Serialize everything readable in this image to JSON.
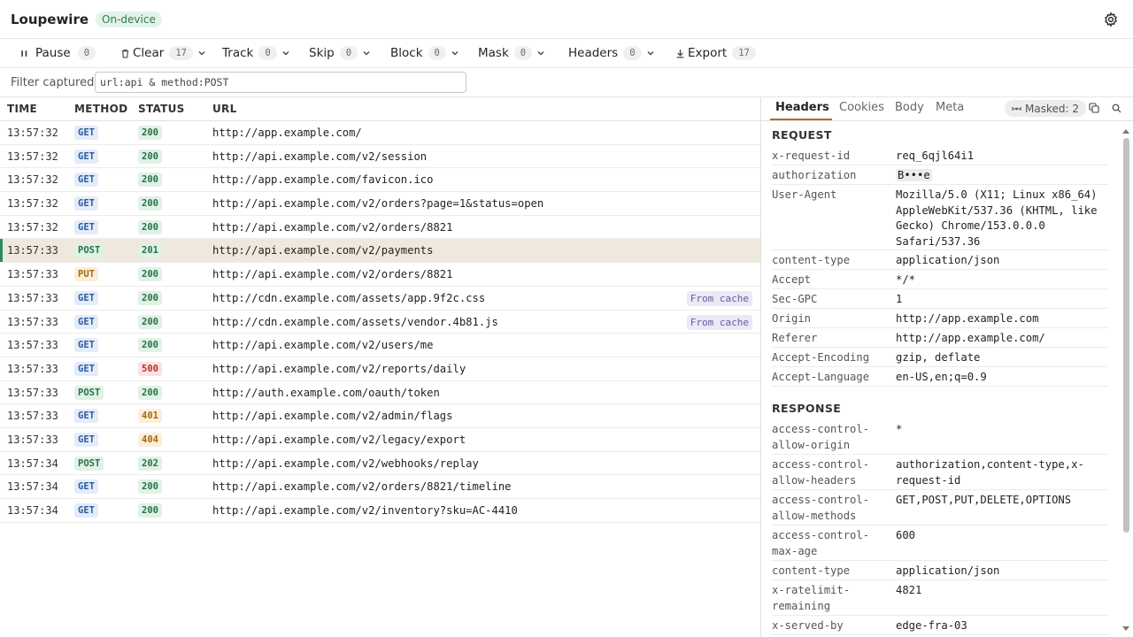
{
  "app": {
    "title": "Loupewire",
    "badge": "On-device"
  },
  "toolbar": {
    "pause": {
      "label": "Pause",
      "count": "0"
    },
    "clear": {
      "label": "Clear",
      "count": "17"
    },
    "track": {
      "label": "Track",
      "count": "0"
    },
    "skip": {
      "label": "Skip",
      "count": "0"
    },
    "block": {
      "label": "Block",
      "count": "0"
    },
    "mask": {
      "label": "Mask",
      "count": "0"
    },
    "headers": {
      "label": "Headers",
      "count": "0"
    },
    "export": {
      "label": "Export",
      "count": "17"
    }
  },
  "filter": {
    "label": "Filter captured",
    "value": "url:api & method:POST"
  },
  "table": {
    "headers": {
      "time": "TIME",
      "method": "METHOD",
      "status": "STATUS",
      "url": "URL"
    },
    "rows": [
      {
        "time": "13:57:32",
        "method": "GET",
        "status": "200",
        "url": "http://app.example.com/"
      },
      {
        "time": "13:57:32",
        "method": "GET",
        "status": "200",
        "url": "http://api.example.com/v2/session"
      },
      {
        "time": "13:57:32",
        "method": "GET",
        "status": "200",
        "url": "http://app.example.com/favicon.ico"
      },
      {
        "time": "13:57:32",
        "method": "GET",
        "status": "200",
        "url": "http://api.example.com/v2/orders?page=1&status=open"
      },
      {
        "time": "13:57:32",
        "method": "GET",
        "status": "200",
        "url": "http://api.example.com/v2/orders/8821"
      },
      {
        "time": "13:57:33",
        "method": "POST",
        "status": "201",
        "url": "http://api.example.com/v2/payments"
      },
      {
        "time": "13:57:33",
        "method": "PUT",
        "status": "200",
        "url": "http://api.example.com/v2/orders/8821"
      },
      {
        "time": "13:57:33",
        "method": "GET",
        "status": "200",
        "url": "http://cdn.example.com/assets/app.9f2c.css",
        "tag": "From cache"
      },
      {
        "time": "13:57:33",
        "method": "GET",
        "status": "200",
        "url": "http://cdn.example.com/assets/vendor.4b81.js",
        "tag": "From cache"
      },
      {
        "time": "13:57:33",
        "method": "GET",
        "status": "200",
        "url": "http://api.example.com/v2/users/me"
      },
      {
        "time": "13:57:33",
        "method": "GET",
        "status": "500",
        "url": "http://api.example.com/v2/reports/daily"
      },
      {
        "time": "13:57:33",
        "method": "POST",
        "status": "200",
        "url": "http://auth.example.com/oauth/token"
      },
      {
        "time": "13:57:33",
        "method": "GET",
        "status": "401",
        "url": "http://api.example.com/v2/admin/flags"
      },
      {
        "time": "13:57:33",
        "method": "GET",
        "status": "404",
        "url": "http://api.example.com/v2/legacy/export"
      },
      {
        "time": "13:57:34",
        "method": "POST",
        "status": "202",
        "url": "http://api.example.com/v2/webhooks/replay"
      },
      {
        "time": "13:57:34",
        "method": "GET",
        "status": "200",
        "url": "http://api.example.com/v2/orders/8821/timeline"
      },
      {
        "time": "13:57:34",
        "method": "GET",
        "status": "200",
        "url": "http://api.example.com/v2/inventory?sku=AC-4410"
      }
    ]
  },
  "detail": {
    "tabs": [
      "Headers",
      "Cookies",
      "Body",
      "Meta"
    ],
    "masked_label": "Masked: 2",
    "request_title": "REQUEST",
    "request": [
      {
        "key": "x-request-id",
        "value": "req_6qjl64i1"
      },
      {
        "key": "authorization",
        "value": "B•••e",
        "masked": true
      },
      {
        "key": "User-Agent",
        "value": "Mozilla/5.0 (X11; Linux x86_64) AppleWebKit/537.36 (KHTML, like Gecko) Chrome/153.0.0.0 Safari/537.36"
      },
      {
        "key": "content-type",
        "value": "application/json"
      },
      {
        "key": "Accept",
        "value": "*/*"
      },
      {
        "key": "Sec-GPC",
        "value": "1"
      },
      {
        "key": "Origin",
        "value": "http://app.example.com"
      },
      {
        "key": "Referer",
        "value": "http://app.example.com/"
      },
      {
        "key": "Accept-Encoding",
        "value": "gzip, deflate"
      },
      {
        "key": "Accept-Language",
        "value": "en-US,en;q=0.9"
      }
    ],
    "response_title": "RESPONSE",
    "response": [
      {
        "key": "access-control-allow-origin",
        "value": "*"
      },
      {
        "key": "access-control-allow-headers",
        "value": "authorization,content-type,x-request-id"
      },
      {
        "key": "access-control-allow-methods",
        "value": "GET,POST,PUT,DELETE,OPTIONS"
      },
      {
        "key": "access-control-max-age",
        "value": "600"
      },
      {
        "key": "content-type",
        "value": "application/json"
      },
      {
        "key": "x-ratelimit-remaining",
        "value": "4821"
      },
      {
        "key": "x-served-by",
        "value": "edge-fra-03"
      }
    ]
  },
  "selected_row": 5
}
